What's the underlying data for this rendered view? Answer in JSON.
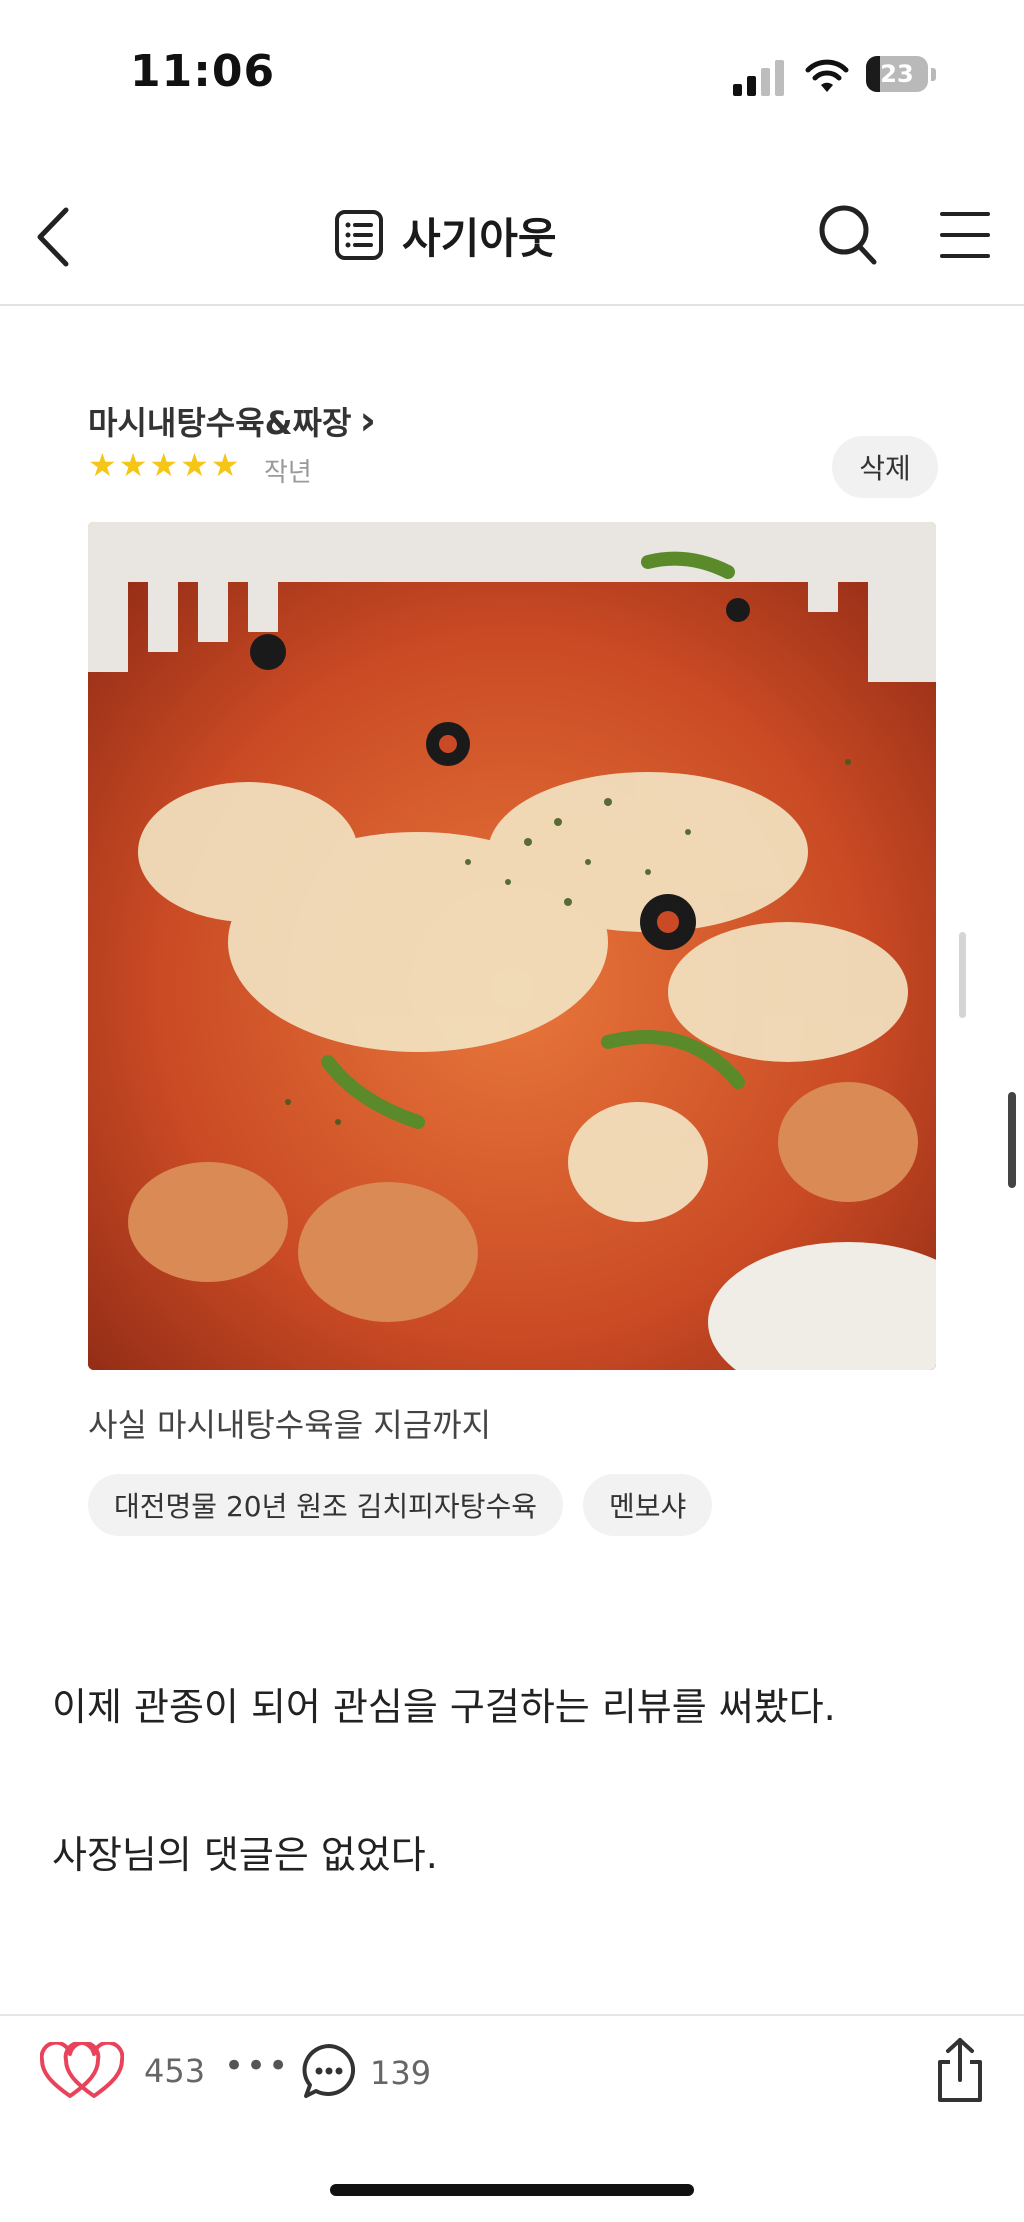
{
  "status_bar": {
    "time": "11:06",
    "battery_level": "23",
    "battery_fraction": 0.23
  },
  "nav": {
    "title": "사기아웃",
    "icons": {
      "back": "chevron-left-icon",
      "title": "list-document-icon",
      "search": "search-icon",
      "menu": "hamburger-menu-icon"
    }
  },
  "review": {
    "store_name": "마시내탕수육&짜장",
    "store_chevron": "›",
    "rating": 5,
    "star_glyph": "★",
    "date": "작년",
    "delete_label": "삭제",
    "text": "사실 마시내탕수육을 지금까지",
    "tags": [
      "대전명물  20년 원조  김치피자탕수육",
      "멘보샤"
    ]
  },
  "body": {
    "lines": [
      "이제 관종이 되어 관심을 구걸하는 리뷰를 써봤다.",
      "사장님의 댓글은 없었다."
    ]
  },
  "bottom_bar": {
    "like_count": "453",
    "more": "•••",
    "comment_count": "139",
    "icons": {
      "like": "double-heart-icon",
      "comment": "speech-bubble-icon",
      "share": "share-icon"
    }
  },
  "colors": {
    "star": "#f5c518",
    "like": "#e8435a"
  }
}
